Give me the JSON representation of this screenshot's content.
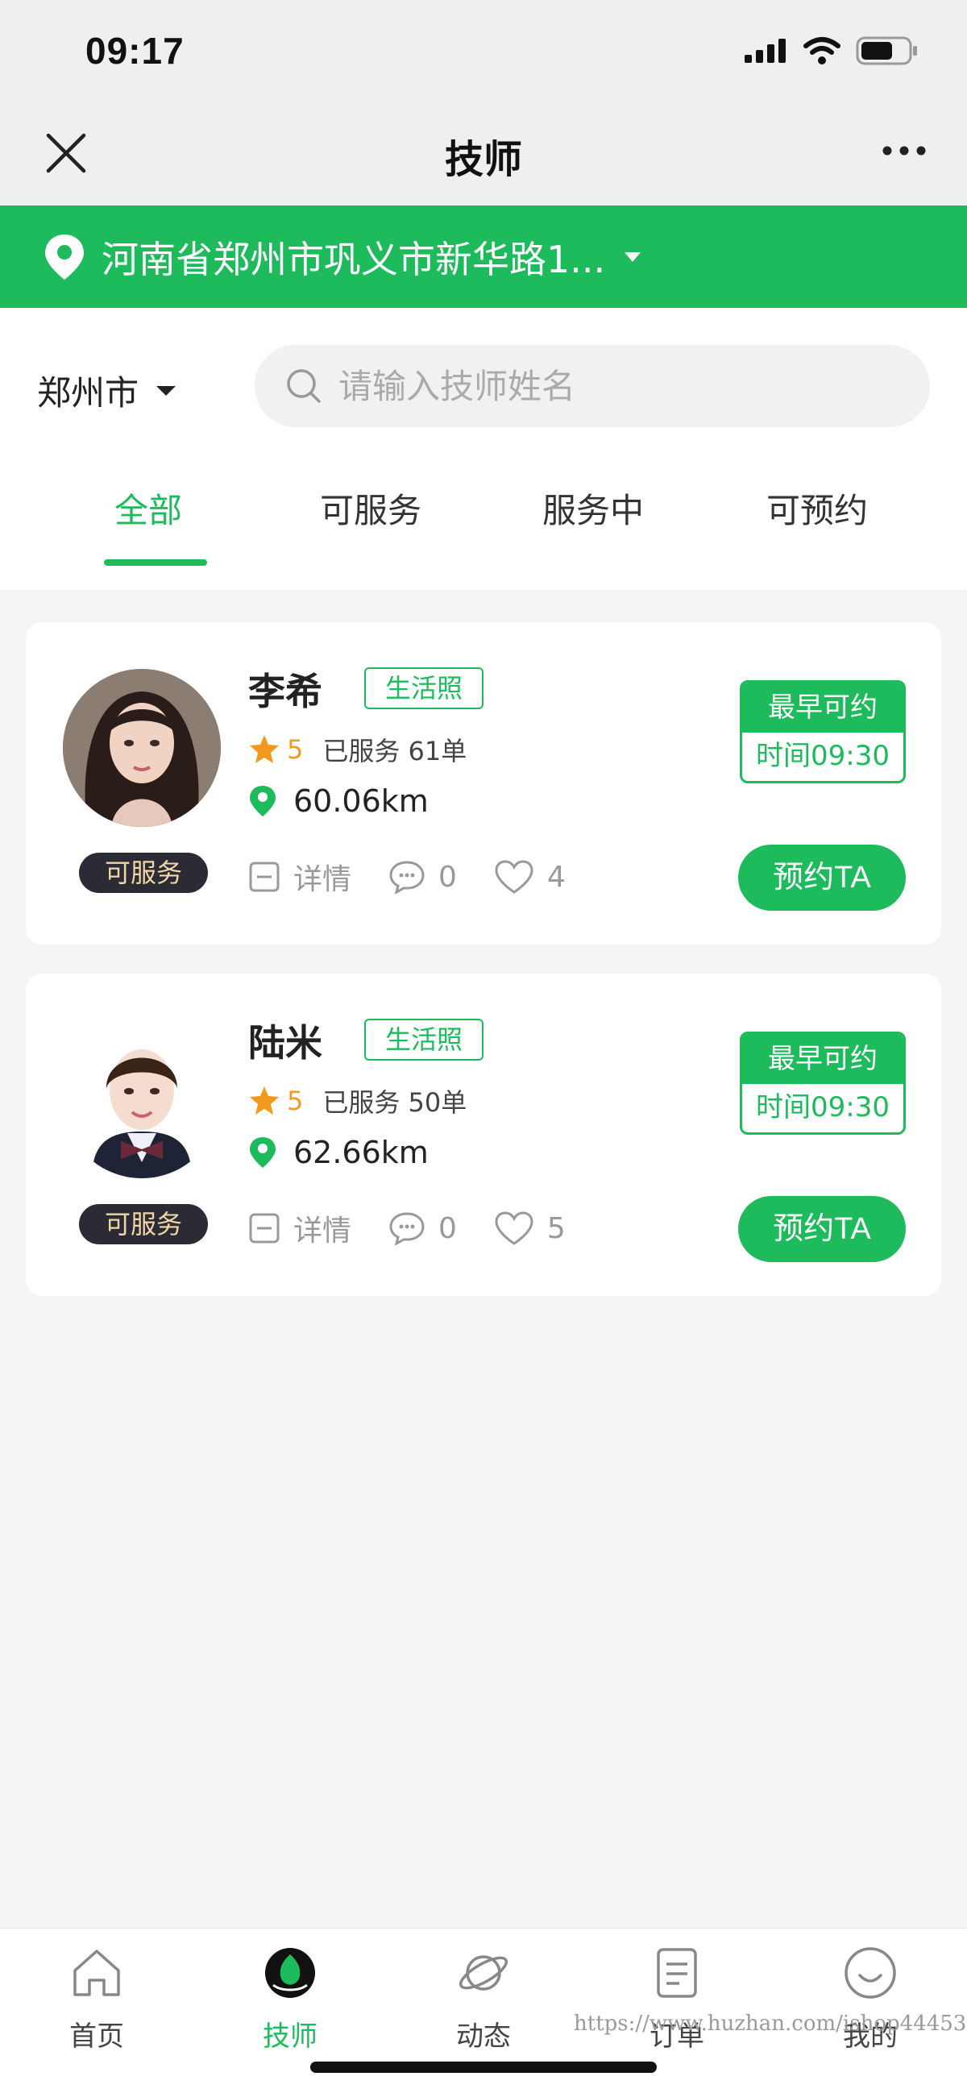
{
  "status_bar": {
    "time": "09:17"
  },
  "nav": {
    "title": "技师"
  },
  "location": {
    "address": "河南省郑州市巩义市新华路1..."
  },
  "filter": {
    "city": "郑州市",
    "search_placeholder": "请输入技师姓名",
    "tabs": [
      "全部",
      "可服务",
      "服务中",
      "可预约"
    ],
    "active_tab": 0
  },
  "technicians": [
    {
      "name": "李希",
      "tag": "生活照",
      "rating": "5",
      "served": "已服务 61单",
      "distance": "60.06km",
      "status": "可服务",
      "detail_label": "详情",
      "comments": "0",
      "likes": "4",
      "earliest_label": "最早可约",
      "earliest_time": "时间09:30",
      "book_label": "预约TA"
    },
    {
      "name": "陆米",
      "tag": "生活照",
      "rating": "5",
      "served": "已服务 50单",
      "distance": "62.66km",
      "status": "可服务",
      "detail_label": "详情",
      "comments": "0",
      "likes": "5",
      "earliest_label": "最早可约",
      "earliest_time": "时间09:30",
      "book_label": "预约TA"
    }
  ],
  "tabbar": {
    "items": [
      {
        "label": "首页",
        "icon": "home-icon"
      },
      {
        "label": "技师",
        "icon": "technician-icon"
      },
      {
        "label": "动态",
        "icon": "planet-icon"
      },
      {
        "label": "订单",
        "icon": "order-icon"
      },
      {
        "label": "我的",
        "icon": "profile-icon"
      }
    ],
    "active": 1
  },
  "watermark": "https://www.huzhan.com/ishop44453",
  "colors": {
    "accent": "#1dbb5c",
    "pill_bg": "#2b2b35",
    "pill_text": "#f1d6a6",
    "star": "#f39a1e"
  }
}
